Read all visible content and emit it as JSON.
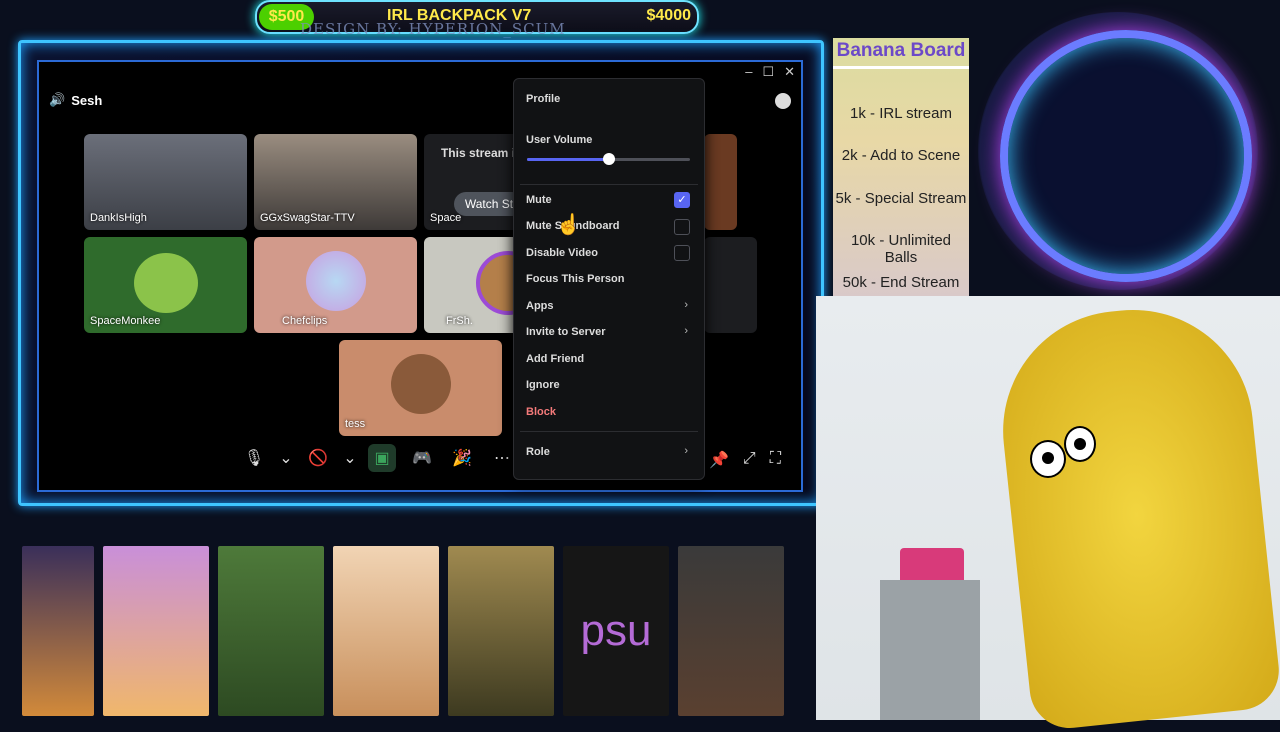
{
  "banner": {
    "goal_low": "$500",
    "title": "IRL BACKPACK V7",
    "goal_high": "$4000",
    "designer": "DESIGN BY: HYPERION_SCUM"
  },
  "discord": {
    "channel": "Sesh",
    "window_controls": [
      "–",
      "☐",
      "✕"
    ],
    "tiles": [
      {
        "name": "DankIsHigh"
      },
      {
        "name": "GGxSwagStar-TTV"
      },
      {
        "name": "Space"
      },
      {
        "name": "SpaceMonkee"
      },
      {
        "name": "Chefclips"
      },
      {
        "name": "FrSh."
      },
      {
        "name": "tess"
      }
    ],
    "hidden_stream": {
      "text": "This stream is hidde",
      "watch_label": "Watch St"
    }
  },
  "context_menu": {
    "profile": "Profile",
    "user_volume": "User Volume",
    "volume_level": 0.5,
    "items": {
      "mute": "Mute",
      "mute_soundboard": "Mute Soundboard",
      "disable_video": "Disable Video",
      "focus": "Focus This Person",
      "apps": "Apps",
      "invite": "Invite to Server",
      "add_friend": "Add Friend",
      "ignore": "Ignore",
      "block": "Block",
      "role": "Role"
    },
    "mute_checked": true
  },
  "banana_board": {
    "title": "Banana Board",
    "items": [
      "1k - IRL stream",
      "2k - Add to Scene",
      "5k - Special Stream",
      "10k - Unlimited Balls",
      "50k - End Stream"
    ]
  },
  "bottom_strip": {
    "psu_text": "psu"
  },
  "colors": {
    "accent": "#5865f2",
    "frame": "#3ec5ff",
    "block": "#f47a7a",
    "goal_green": "#4cd000"
  }
}
